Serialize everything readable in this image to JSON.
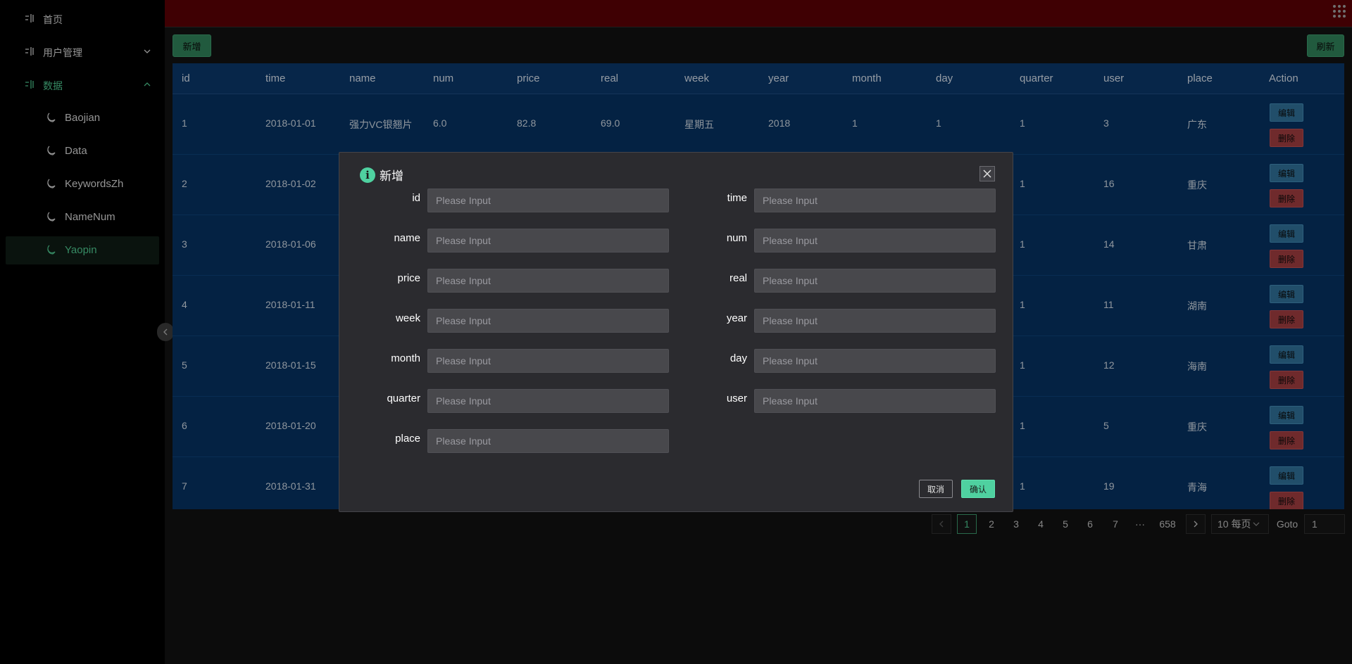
{
  "sidebar": {
    "items": [
      {
        "label": "首页"
      },
      {
        "label": "用户管理"
      },
      {
        "label": "数据"
      },
      {
        "label": "Baojian"
      },
      {
        "label": "Data"
      },
      {
        "label": "KeywordsZh"
      },
      {
        "label": "NameNum"
      },
      {
        "label": "Yaopin"
      }
    ]
  },
  "toolbar": {
    "add_label": "新增",
    "refresh_label": "刷新"
  },
  "table": {
    "columns": [
      "id",
      "time",
      "name",
      "num",
      "price",
      "real",
      "week",
      "year",
      "month",
      "day",
      "quarter",
      "user",
      "place",
      "Action"
    ],
    "rows": [
      {
        "id": "1",
        "time": "2018-01-01",
        "name": "强力VC银翘片",
        "num": "6.0",
        "price": "82.8",
        "real": "69.0",
        "week": "星期五",
        "year": "2018",
        "month": "1",
        "day": "1",
        "quarter": "1",
        "user": "3",
        "place": "广东"
      },
      {
        "id": "2",
        "time": "2018-01-02",
        "quarter": "1",
        "user": "16",
        "place": "重庆"
      },
      {
        "id": "3",
        "time": "2018-01-06",
        "quarter": "1",
        "user": "14",
        "place": "甘肃"
      },
      {
        "id": "4",
        "time": "2018-01-11",
        "quarter": "1",
        "user": "11",
        "place": "湖南"
      },
      {
        "id": "5",
        "time": "2018-01-15",
        "quarter": "1",
        "user": "12",
        "place": "海南"
      },
      {
        "id": "6",
        "time": "2018-01-20",
        "quarter": "1",
        "user": "5",
        "place": "重庆"
      },
      {
        "id": "7",
        "time": "2018-01-31",
        "quarter": "1",
        "user": "19",
        "place": "青海"
      }
    ],
    "edit_label": "编辑",
    "delete_label": "删除"
  },
  "pagination": {
    "pages": [
      "1",
      "2",
      "3",
      "4",
      "5",
      "6",
      "7",
      "···",
      "658"
    ],
    "current_page": "1",
    "page_size": "10 每页",
    "goto_label": "Goto",
    "goto_value": "1"
  },
  "dialog": {
    "title": "新增",
    "placeholder": "Please Input",
    "fields": [
      "id",
      "time",
      "name",
      "num",
      "price",
      "real",
      "week",
      "year",
      "month",
      "day",
      "quarter",
      "user",
      "place"
    ],
    "cancel_label": "取消",
    "confirm_label": "确认"
  },
  "colors": {
    "accent": "#4bbf8a",
    "topbar": "#580005",
    "table_bg": "#06305e",
    "edit_button": "#2e6d93",
    "delete_button": "#9a3b3e",
    "dialog_bg": "#2b2b2f"
  },
  "icons": {
    "menu": "menu-icon",
    "data_item": "moon-icon",
    "close": "close-icon",
    "info": "info-icon",
    "apps": "grid-apps-icon"
  }
}
